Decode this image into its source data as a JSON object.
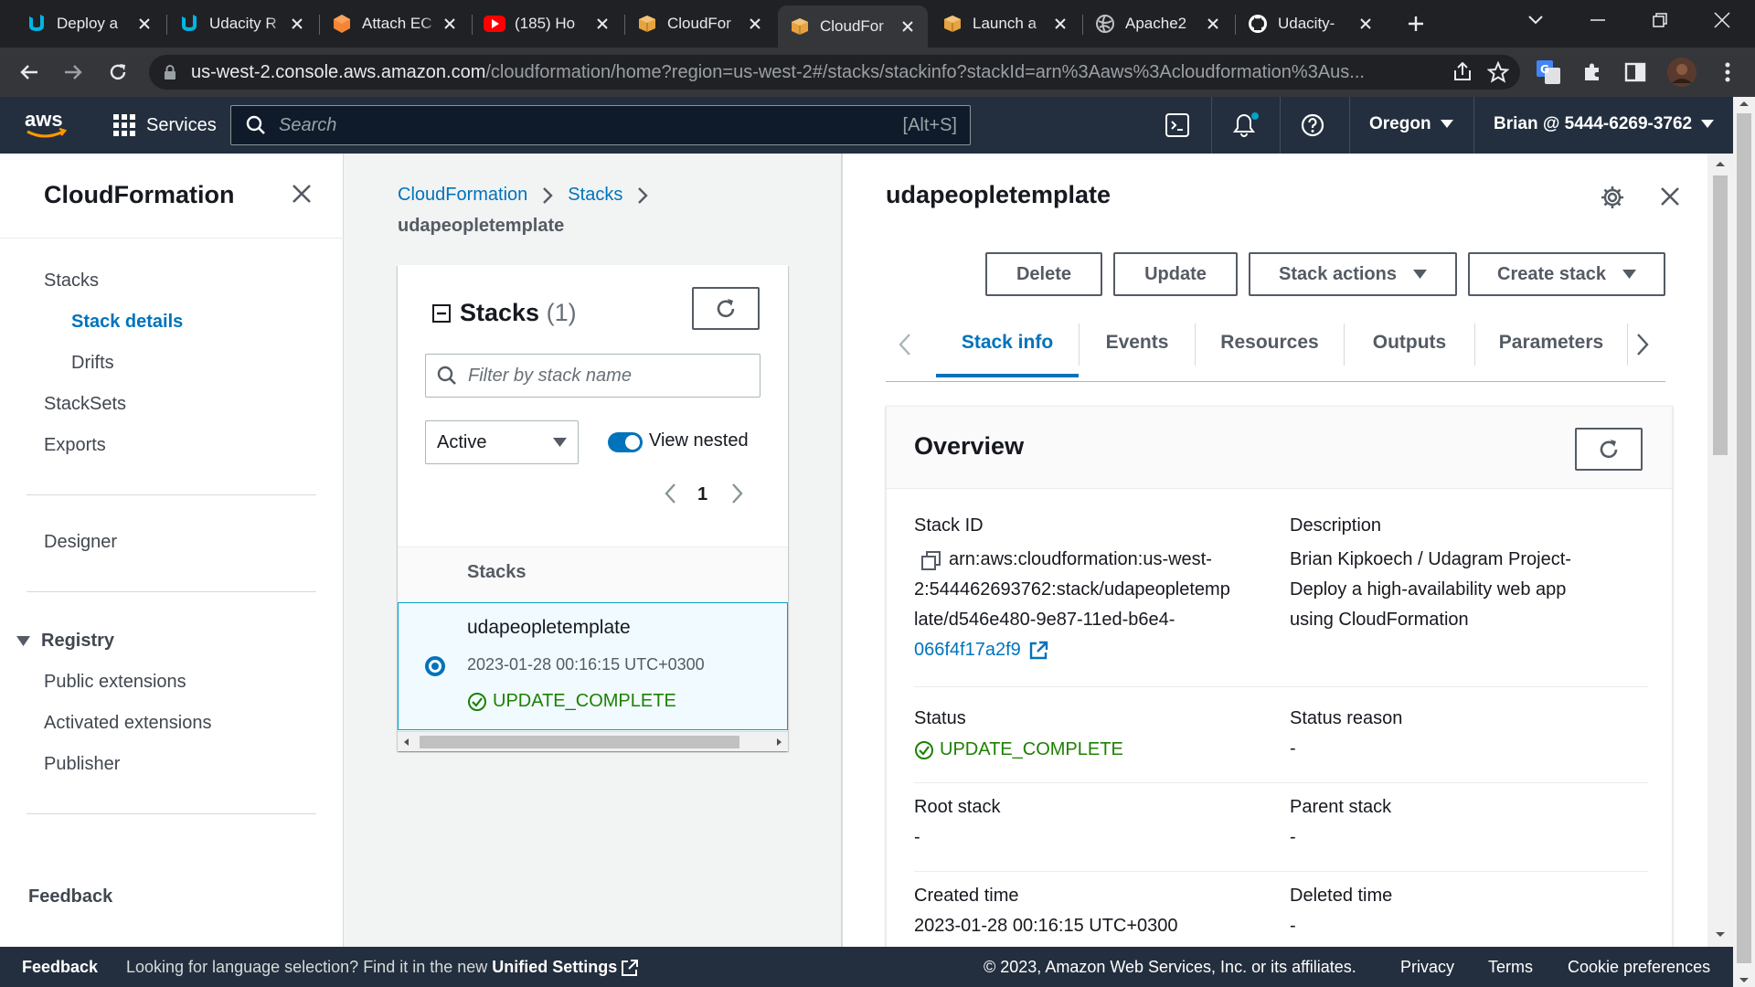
{
  "browser": {
    "tabs": [
      {
        "title": "Deploy a",
        "icon": "udacity-icon"
      },
      {
        "title": "Udacity R",
        "icon": "udacity-icon"
      },
      {
        "title": "Attach EC",
        "icon": "aws-ec2-icon"
      },
      {
        "title": "(185) Ho",
        "icon": "youtube-icon"
      },
      {
        "title": "CloudFor",
        "icon": "aws-cloudformation-icon"
      },
      {
        "title": "CloudFor",
        "icon": "aws-cloudformation-icon"
      },
      {
        "title": "Launch a",
        "icon": "aws-cloudformation-icon"
      },
      {
        "title": "Apache2",
        "icon": "globe-icon"
      },
      {
        "title": "Udacity-",
        "icon": "github-icon"
      }
    ],
    "active_tab_index": 5,
    "url_host": "us-west-2.console.aws.amazon.com",
    "url_path": "/cloudformation/home?region=us-west-2#/stacks/stackinfo?stackId=arn%3Aaws%3Acloudformation%3Aus..."
  },
  "aws_header": {
    "services_label": "Services",
    "search_placeholder": "Search",
    "search_shortcut": "[Alt+S]",
    "region": "Oregon",
    "account": "Brian @ 5444-6269-3762"
  },
  "sidenav": {
    "title": "CloudFormation",
    "stacks": "Stacks",
    "stack_details": "Stack details",
    "drifts": "Drifts",
    "stacksets": "StackSets",
    "exports": "Exports",
    "designer": "Designer",
    "registry": "Registry",
    "public_extensions": "Public extensions",
    "activated_extensions": "Activated extensions",
    "publisher": "Publisher",
    "feedback": "Feedback"
  },
  "middle": {
    "breadcrumb_1": "CloudFormation",
    "breadcrumb_2": "Stacks",
    "breadcrumb_current": "udapeopletemplate",
    "card_title": "Stacks",
    "card_count": "(1)",
    "filter_placeholder": "Filter by stack name",
    "status_filter": "Active",
    "view_nested_label": "View nested",
    "view_nested_on": true,
    "page_number": "1",
    "column_header": "Stacks",
    "row": {
      "name": "udapeopletemplate",
      "time": "2023-01-28 00:16:15 UTC+0300",
      "status": "UPDATE_COMPLETE"
    }
  },
  "right": {
    "stack_name": "udapeopletemplate",
    "buttons": {
      "delete": "Delete",
      "update": "Update",
      "stack_actions": "Stack actions",
      "create_stack": "Create stack"
    },
    "tabs": [
      "Stack info",
      "Events",
      "Resources",
      "Outputs",
      "Parameters"
    ],
    "active_tab": "Stack info",
    "overview_title": "Overview",
    "stack_id_label": "Stack ID",
    "stack_id_lines": [
      "arn:aws:cloudformation:us-west-",
      "2:544462693762:stack/udapeopletemp",
      "late/d546e480-9e87-11ed-b6e4-",
      "066f4f17a2f9"
    ],
    "description_label": "Description",
    "description_lines": [
      "Brian Kipkoech / Udagram Project-",
      "Deploy a high-availability web app",
      "using CloudFormation"
    ],
    "status_label": "Status",
    "status_value": "UPDATE_COMPLETE",
    "status_reason_label": "Status reason",
    "status_reason_value": "-",
    "root_stack_label": "Root stack",
    "root_stack_value": "-",
    "parent_stack_label": "Parent stack",
    "parent_stack_value": "-",
    "created_time_label": "Created time",
    "created_time_value": "2023-01-28 00:16:15 UTC+0300",
    "deleted_time_label": "Deleted time",
    "deleted_time_value": "-"
  },
  "footer": {
    "feedback": "Feedback",
    "language_text": "Looking for language selection? Find it in the new",
    "unified_settings": "Unified Settings",
    "copyright": "© 2023, Amazon Web Services, Inc. or its affiliates.",
    "privacy": "Privacy",
    "terms": "Terms",
    "cookie": "Cookie preferences"
  },
  "colors": {
    "aws_navy": "#232f3e",
    "link_blue": "#0073bb",
    "success_green": "#1d8102",
    "tab_active": "#0073bb"
  }
}
